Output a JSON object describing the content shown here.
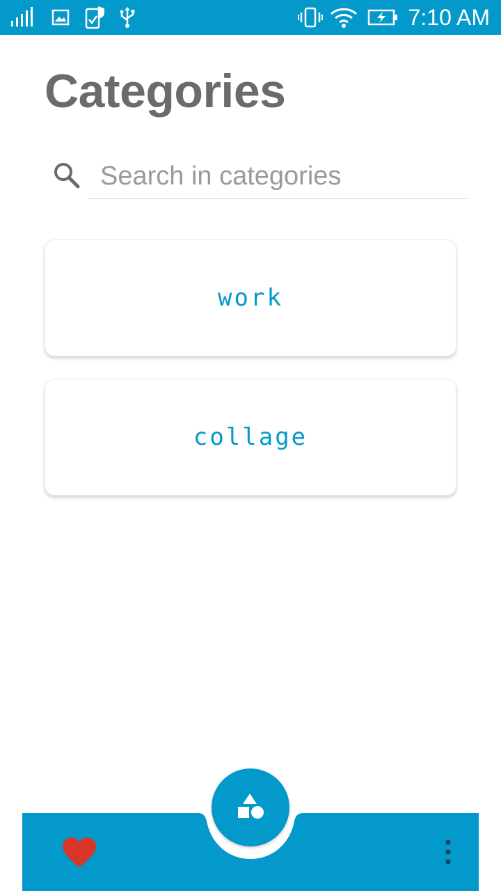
{
  "status_bar": {
    "time": "7:10 AM",
    "icons": [
      "signal-icon",
      "image-notification-icon",
      "secure-device-icon",
      "usb-icon",
      "vibrate-icon",
      "wifi-icon",
      "battery-charging-icon"
    ]
  },
  "header": {
    "title": "Categories"
  },
  "search": {
    "placeholder": "Search in categories",
    "value": ""
  },
  "categories": [
    {
      "label": "work"
    },
    {
      "label": "collage"
    }
  ],
  "bottom_bar": {
    "left_icon": "heart-icon",
    "fab_icon": "shapes-icon",
    "right_icon": "more-vert-icon"
  },
  "colors": {
    "accent": "#0399cb",
    "title": "#6b6b6b",
    "heart": "#d9362b"
  }
}
